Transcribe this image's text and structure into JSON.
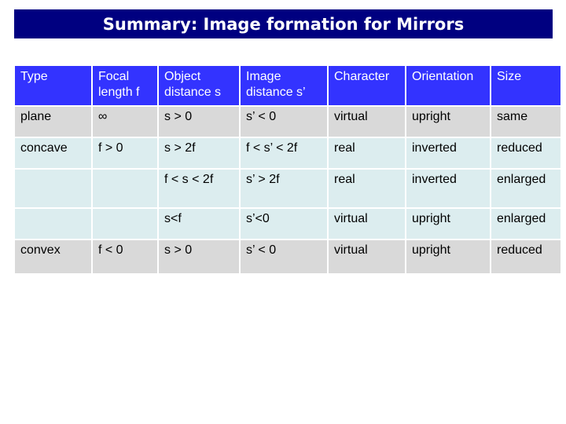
{
  "title": "Summary: Image formation for Mirrors",
  "table": {
    "headers": [
      "Type",
      "Focal length f",
      "Object distance s",
      "Image distance s’",
      "Character",
      "Orientation",
      "Size"
    ],
    "rows": [
      [
        "plane",
        "∞",
        "s > 0",
        "s’ < 0",
        "virtual",
        "upright",
        "same"
      ],
      [
        "concave",
        "f > 0",
        "s > 2f",
        "f < s’ < 2f",
        "real",
        "inverted",
        "reduced"
      ],
      [
        "",
        "",
        "f < s < 2f",
        "s’ > 2f",
        "real",
        "inverted",
        "enlarged"
      ],
      [
        "",
        "",
        "s<f",
        "s’<0",
        "virtual",
        "upright",
        "enlarged"
      ],
      [
        "convex",
        "f < 0",
        "s > 0",
        "s’ < 0",
        "virtual",
        "upright",
        "reduced"
      ]
    ]
  },
  "colors": {
    "title_bg": "#000080",
    "header_bg": "#3333ff",
    "row_gray": "#d9d9d9",
    "row_cyan": "#dcedef"
  }
}
